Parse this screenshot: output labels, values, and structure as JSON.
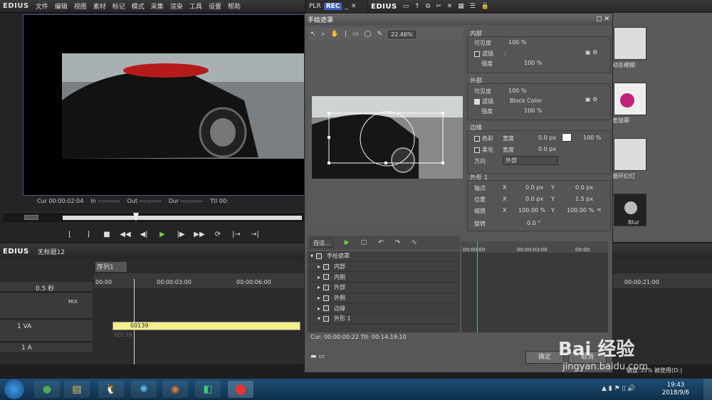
{
  "app": {
    "logo": "EDIUS"
  },
  "menu": [
    "文件",
    "编辑",
    "视图",
    "素材",
    "标记",
    "模式",
    "采集",
    "渲染",
    "工具",
    "设置",
    "帮助"
  ],
  "player": {
    "timecodes": {
      "cur": "Cur 00:00:02:04",
      "in": "In --:--:--:--",
      "out": "Out --:--:--:--",
      "dur": "Dur --:--:--:--",
      "ttl": "Ttl 00:"
    }
  },
  "recorder": {
    "plr": "PLR",
    "rec": "REC"
  },
  "secondary": {
    "logo": "EDIUS"
  },
  "effects": {
    "items": [
      "动态模糊",
      "宽银幕",
      "循环幻灯",
      "Blur"
    ]
  },
  "dialog": {
    "title": "手绘遮罩",
    "zoom": "22.46%",
    "inner": {
      "title": "内部",
      "visibility_label": "可见度",
      "visibility_value": "100 %",
      "filter_label": "滤镜",
      "filter_value": ":",
      "strength_label": "强度",
      "strength_value": "100 %"
    },
    "outer": {
      "title": "外部",
      "visibility_label": "可见度",
      "visibility_value": "100 %",
      "filter_label": "滤镜",
      "filter_value": "Block Color",
      "strength_label": "强度",
      "strength_value": "100 %"
    },
    "edge": {
      "title": "边缘",
      "color_label": "色彩",
      "width_label": "宽度",
      "width_value": "0.0 px",
      "opacity_value": "100 %",
      "soft_label": "柔化",
      "soft_width_label": "宽度",
      "soft_width_value": "0.0 px",
      "direction_label": "方向",
      "direction_value": "外部"
    },
    "shape": {
      "title": "外形 1",
      "anchor_label": "轴点",
      "anchor_x": "0.0 px",
      "anchor_y": "0.0 px",
      "pos_label": "位置",
      "pos_x": "0.0 px",
      "pos_y": "1.5 px",
      "scale_label": "缩放",
      "scale_x": "100.00 %",
      "scale_y": "100.00 %",
      "rotate_label": "旋转",
      "rotate_value": "0.0 °",
      "x": "X",
      "y": "Y"
    },
    "kf_preset": "自适...",
    "kf_tracks": [
      "手绘遮罩",
      "内部",
      "内侧",
      "外部",
      "外侧",
      "边缘",
      "外形 1"
    ],
    "kf_times": [
      "00:00:00",
      "00:00:03:00",
      "00:00"
    ],
    "status": "Cur: 00:00:00:22  Ttl: 00:14:19:10",
    "ok_label": "确定",
    "cancel_label": "取消"
  },
  "timeline": {
    "project": "无标题12",
    "sequence_tab": "序列1",
    "scale": "0.5 秒",
    "ruler": [
      "00:00",
      "00:00:03:00",
      "00:00:06:00",
      "00:00:21:00"
    ],
    "tracks": [
      {
        "name": "",
        "extra": "MIX"
      },
      {
        "name": "1 VA",
        "extra": ""
      },
      {
        "name": "1 A",
        "extra": ""
      }
    ],
    "clip_name": "00139",
    "clip_sub": "00139",
    "disk": "磁盘:35% 被使用(D:)"
  },
  "taskbar": {
    "time": "19:43",
    "date": "2018/9/6"
  },
  "watermark": {
    "brand": "Bai 经验",
    "url": "jingyan.baidu.com"
  }
}
